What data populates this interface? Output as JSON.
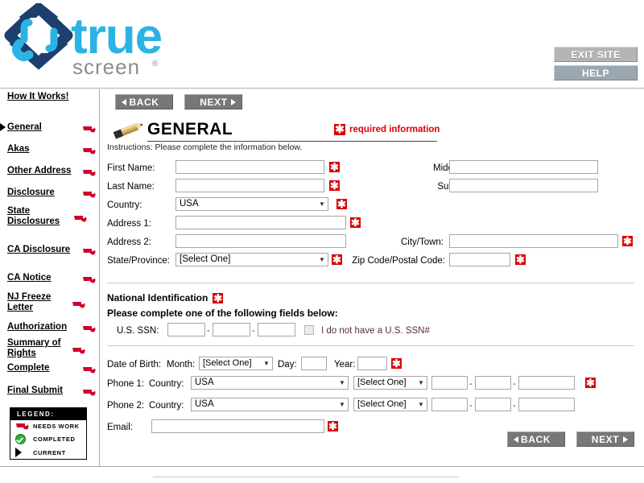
{
  "brand": {
    "name_main": "true",
    "name_sub": "screen",
    "registered_mark": "®",
    "color_dark": "#1c3f6e",
    "color_light": "#2cb3e6",
    "color_sub": "#8c8c8c"
  },
  "top_buttons": [
    {
      "id": "exit-site",
      "label": "EXIT SITE"
    },
    {
      "id": "help",
      "label": "HELP"
    }
  ],
  "sidebar": {
    "items": [
      {
        "label": "How It Works!",
        "flag": false,
        "current": false
      },
      {
        "label": "General",
        "flag": true,
        "current": true
      },
      {
        "label": "Akas",
        "flag": true,
        "current": false
      },
      {
        "label": "Other Address",
        "flag": true,
        "current": false
      },
      {
        "label": "Disclosure",
        "flag": true,
        "current": false
      },
      {
        "label": "State Disclosures",
        "flag": true,
        "current": false
      },
      {
        "label": "CA Disclosure",
        "flag": true,
        "current": false
      },
      {
        "label": "CA Notice",
        "flag": true,
        "current": false
      },
      {
        "label": "NJ Freeze Letter",
        "flag": true,
        "current": false
      },
      {
        "label": "Authorization",
        "flag": true,
        "current": false
      },
      {
        "label": "Summary of Rights",
        "flag": true,
        "current": false
      },
      {
        "label": "Complete",
        "flag": true,
        "current": false
      },
      {
        "label": "Final Submit",
        "flag": true,
        "current": false
      }
    ],
    "legend": {
      "title": "LEGEND:",
      "rows": [
        {
          "icon": "needs-work-flag-icon",
          "label": "NEEDS WORK"
        },
        {
          "icon": "completed-check-icon",
          "label": "COMPLETED"
        },
        {
          "icon": "current-arrow-icon",
          "label": "CURRENT"
        }
      ]
    }
  },
  "nav": {
    "back_label": "BACK",
    "next_label": "NEXT"
  },
  "section": {
    "title": "GENERAL",
    "required_note": "required information",
    "required_marker": "✱",
    "instructions": "Instructions: Please complete the information below."
  },
  "form": {
    "first_name": {
      "label": "First Name:",
      "value": "",
      "required": true
    },
    "middle_name": {
      "label": "Middle Name:",
      "value": "",
      "required": false
    },
    "last_name": {
      "label": "Last Name:",
      "value": "",
      "required": true
    },
    "suffix_name": {
      "label": "Suffix Name:",
      "value": "",
      "required": false
    },
    "country": {
      "label": "Country:",
      "value": "USA",
      "required": true
    },
    "address1": {
      "label": "Address 1:",
      "value": "",
      "required": true
    },
    "address2": {
      "label": "Address 2:",
      "value": "",
      "required": false
    },
    "city": {
      "label": "City/Town:",
      "value": "",
      "required": true
    },
    "state": {
      "label": "State/Province:",
      "value": "[Select One]",
      "required": true
    },
    "zip": {
      "label": "Zip Code/Postal Code:",
      "value": "",
      "required": true
    }
  },
  "national_id": {
    "heading": "National Identification",
    "subheading": "Please complete one of the following fields below:",
    "ssn_label": "U.S. SSN:",
    "ssn_part1": "",
    "ssn_part2": "",
    "ssn_part3": "",
    "separator": "-",
    "no_ssn_label": "I do not have a U.S. SSN#",
    "no_ssn_checked": false
  },
  "dob": {
    "label": "Date of Birth:",
    "month_label": "Month:",
    "month_value": "[Select One]",
    "day_label": "Day:",
    "day_value": "",
    "year_label": "Year:",
    "year_value": "",
    "required": true
  },
  "phones": [
    {
      "label": "Phone 1:",
      "country_label": "Country:",
      "country_value": "USA",
      "type_value": "[Select One]",
      "p1": "",
      "p2": "",
      "p3": "",
      "separator": "-",
      "required": true
    },
    {
      "label": "Phone 2:",
      "country_label": "Country:",
      "country_value": "USA",
      "type_value": "[Select One]",
      "p1": "",
      "p2": "",
      "p3": "",
      "separator": "-",
      "required": false
    }
  ],
  "email": {
    "label": "Email:",
    "value": "",
    "required": true
  },
  "colors": {
    "required_red": "#d60000",
    "flag_red": "#d0002a",
    "button_gray": "#777777",
    "help_blue_gray": "#9aa7b0"
  }
}
